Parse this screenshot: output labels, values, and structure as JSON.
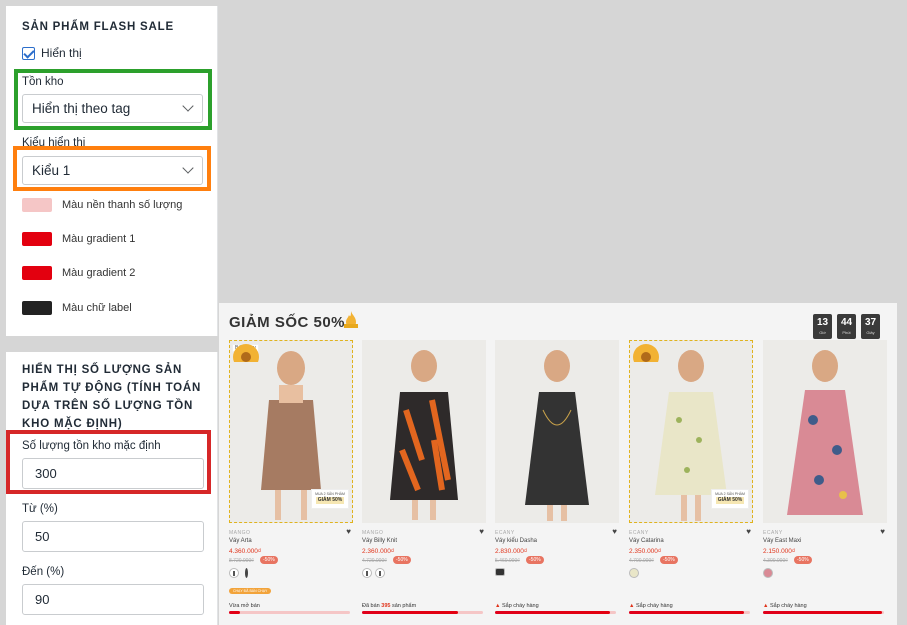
{
  "settings": {
    "flash_section_title": "SẢN PHẨM FLASH SALE",
    "show_label": "Hiển thị",
    "show_checked": true,
    "stock_label": "Tồn kho",
    "stock_value": "Hiển thị theo tag",
    "style_label": "Kiểu hiển thị",
    "style_value": "Kiểu 1",
    "colors": [
      {
        "label": "Màu nền thanh số lượng",
        "color": "#f5c6c6"
      },
      {
        "label": "Màu gradient 1",
        "color": "#e3000f"
      },
      {
        "label": "Màu gradient 2",
        "color": "#e3000f"
      },
      {
        "label": "Màu chữ label",
        "color": "#222222"
      }
    ],
    "auto_section_title": "HIỂN THỊ SỐ LƯỢNG SẢN PHẨM TỰ ĐỘNG (TÍNH TOÁN DỰA TRÊN SỐ LƯỢNG TỒN KHO MẶC ĐỊNH)",
    "default_stock_label": "Số lượng tồn kho mặc định",
    "default_stock_value": "300",
    "from_label": "Từ (%)",
    "from_value": "50",
    "to_label": "Đến (%)",
    "to_value": "90"
  },
  "preview": {
    "title": "GIẢM SỐC 50%",
    "countdown": [
      {
        "value": "13",
        "unit": "Giờ"
      },
      {
        "value": "44",
        "unit": "Phút"
      },
      {
        "value": "37",
        "unit": "Giây"
      }
    ],
    "products": [
      {
        "brand": "MANGO",
        "name": "Váy Arta",
        "price": "4.360.000₫",
        "old_price": "8.720.000₫",
        "discount": "-50%",
        "badge": "Bán chạy",
        "sale_tag_1": "MUA 2 SẢN PHẨM",
        "sale_tag_2": "GIẢM 50%",
        "promo": "CHẠY ĐÃ BÁN CHẠY",
        "status_text": "Vừa mở bán",
        "status_count": "",
        "progress": 0.09
      },
      {
        "brand": "MANGO",
        "name": "Váy Billy Knit",
        "price": "2.360.000₫",
        "old_price": "4.720.000₫",
        "discount": "-50%",
        "status_text": "Đã bán",
        "status_count": "395",
        "status_suffix": "sản phẩm",
        "progress": 0.79
      },
      {
        "brand": "ECANY",
        "name": "Váy kiểu Dasha",
        "price": "2.830.000₫",
        "old_price": "5.460.000₫",
        "discount": "-50%",
        "status_text": "Sắp cháy hàng",
        "status_count": "",
        "progress": 0.95
      },
      {
        "brand": "ECANY",
        "name": "Váy Catarina",
        "price": "2.350.000₫",
        "old_price": "4.700.000₫",
        "discount": "-50%",
        "sale_tag_1": "MUA 2 SẢN PHẨM",
        "sale_tag_2": "GIẢM 50%",
        "status_text": "Sắp cháy hàng",
        "status_count": "",
        "progress": 0.95
      },
      {
        "brand": "ECANY",
        "name": "Váy East Maxi",
        "price": "2.150.000₫",
        "old_price": "4.300.000₫",
        "discount": "-50%",
        "status_text": "Sắp cháy hàng",
        "status_count": "",
        "progress": 0.98
      }
    ]
  }
}
